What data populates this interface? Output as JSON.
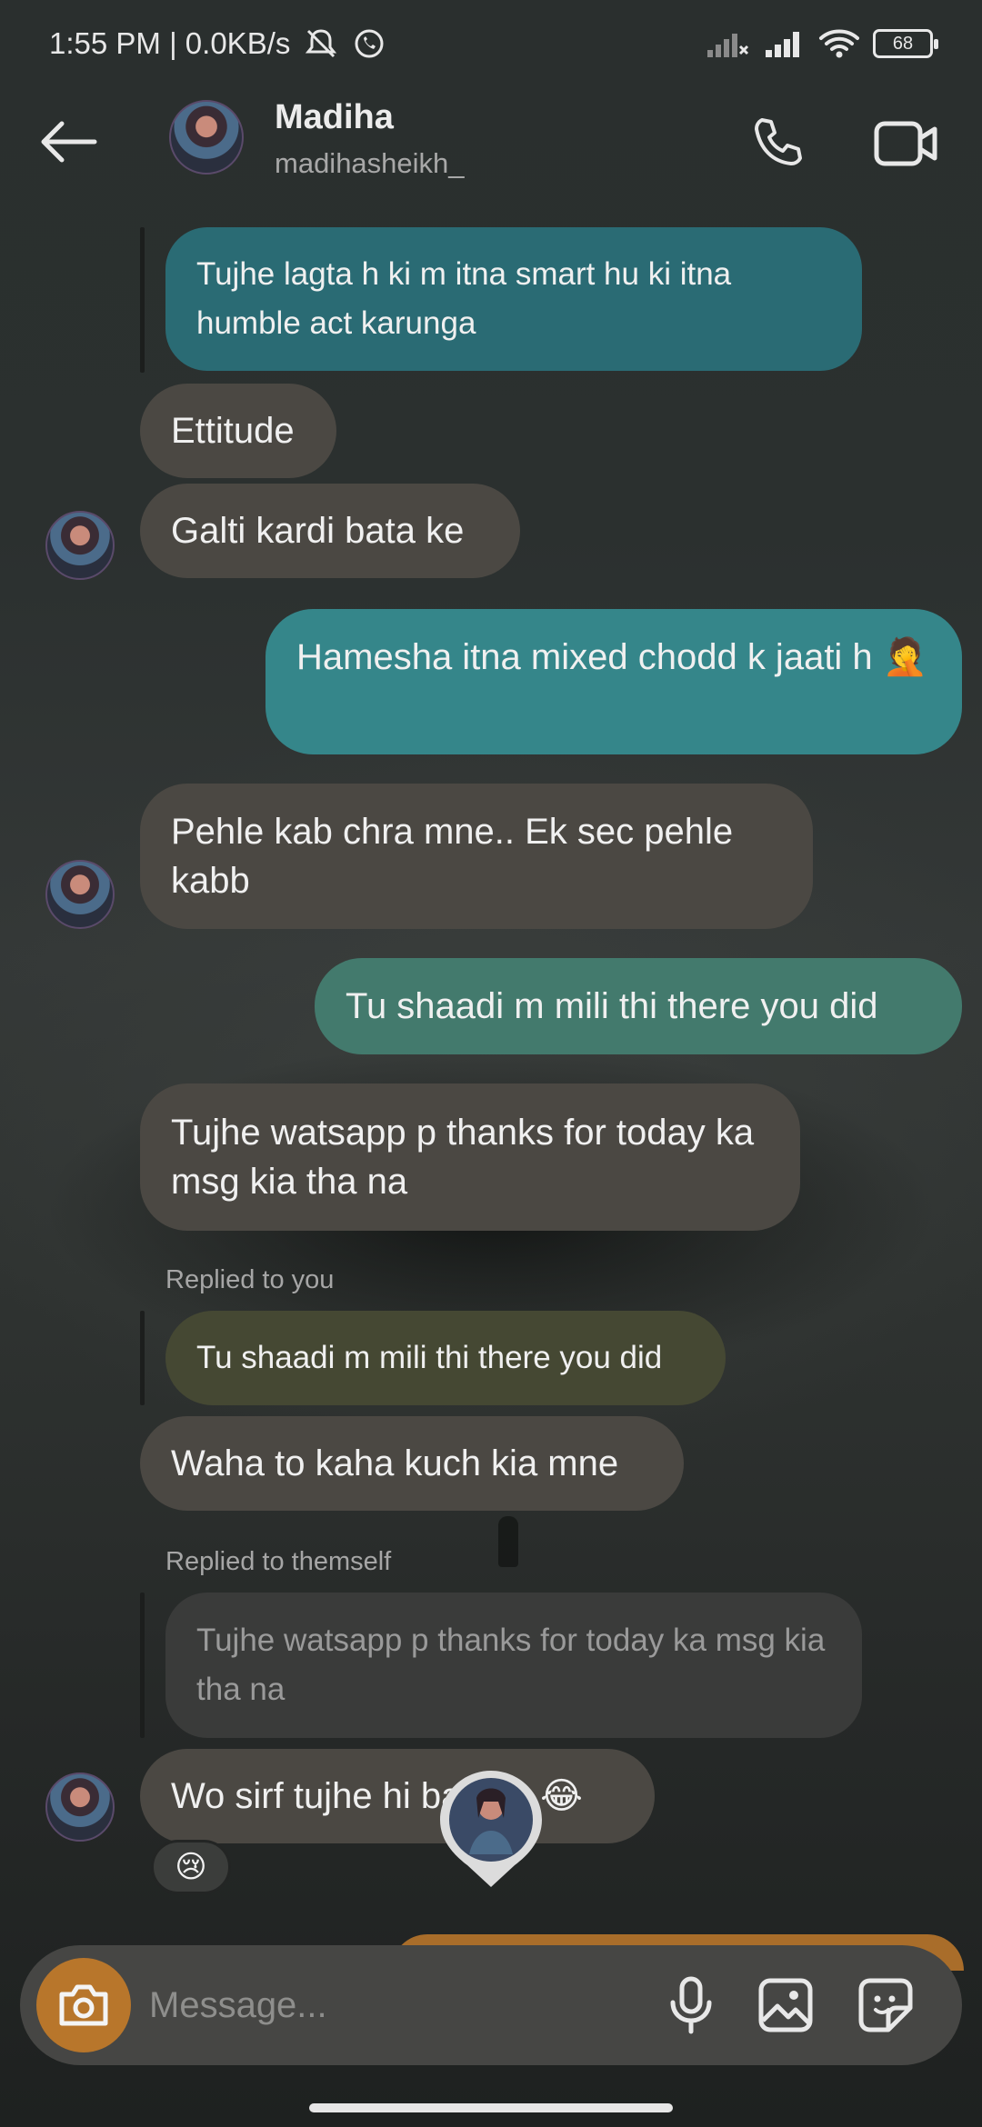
{
  "status_bar": {
    "time_speed": "1:55 PM | 0.0KB/s",
    "battery": "68"
  },
  "header": {
    "name": "Madiha",
    "handle": "madihasheikh_"
  },
  "messages": [
    {
      "text": "Tujhe lagta h ki m itna smart hu ki itna humble act karunga"
    },
    {
      "text": "Ettitude"
    },
    {
      "text": "Galti kardi bata ke"
    },
    {
      "text": "Hamesha itna mixed chodd k jaati h 🤦"
    },
    {
      "text": "Pehle kab chra mne.. Ek sec pehle kabb"
    },
    {
      "text": "Tu shaadi m mili thi there you did"
    },
    {
      "text": "Tujhe watsapp p thanks for today ka msg kia tha na"
    },
    {
      "caption": "Replied to you",
      "quote": "Tu shaadi m mili thi there you did"
    },
    {
      "text": "Waha to kaha kuch kia mne"
    },
    {
      "caption": "Replied to themself",
      "quote": "Tujhe watsapp p thanks for today ka msg kia tha na"
    },
    {
      "text": "Wo sirf tujhe hi bataya 😂",
      "reaction": "😢"
    }
  ],
  "composer": {
    "placeholder": "Message..."
  },
  "colors": {
    "accent": "#b8762b",
    "incoming": "#4b4843",
    "outgoing": "#35868a"
  }
}
